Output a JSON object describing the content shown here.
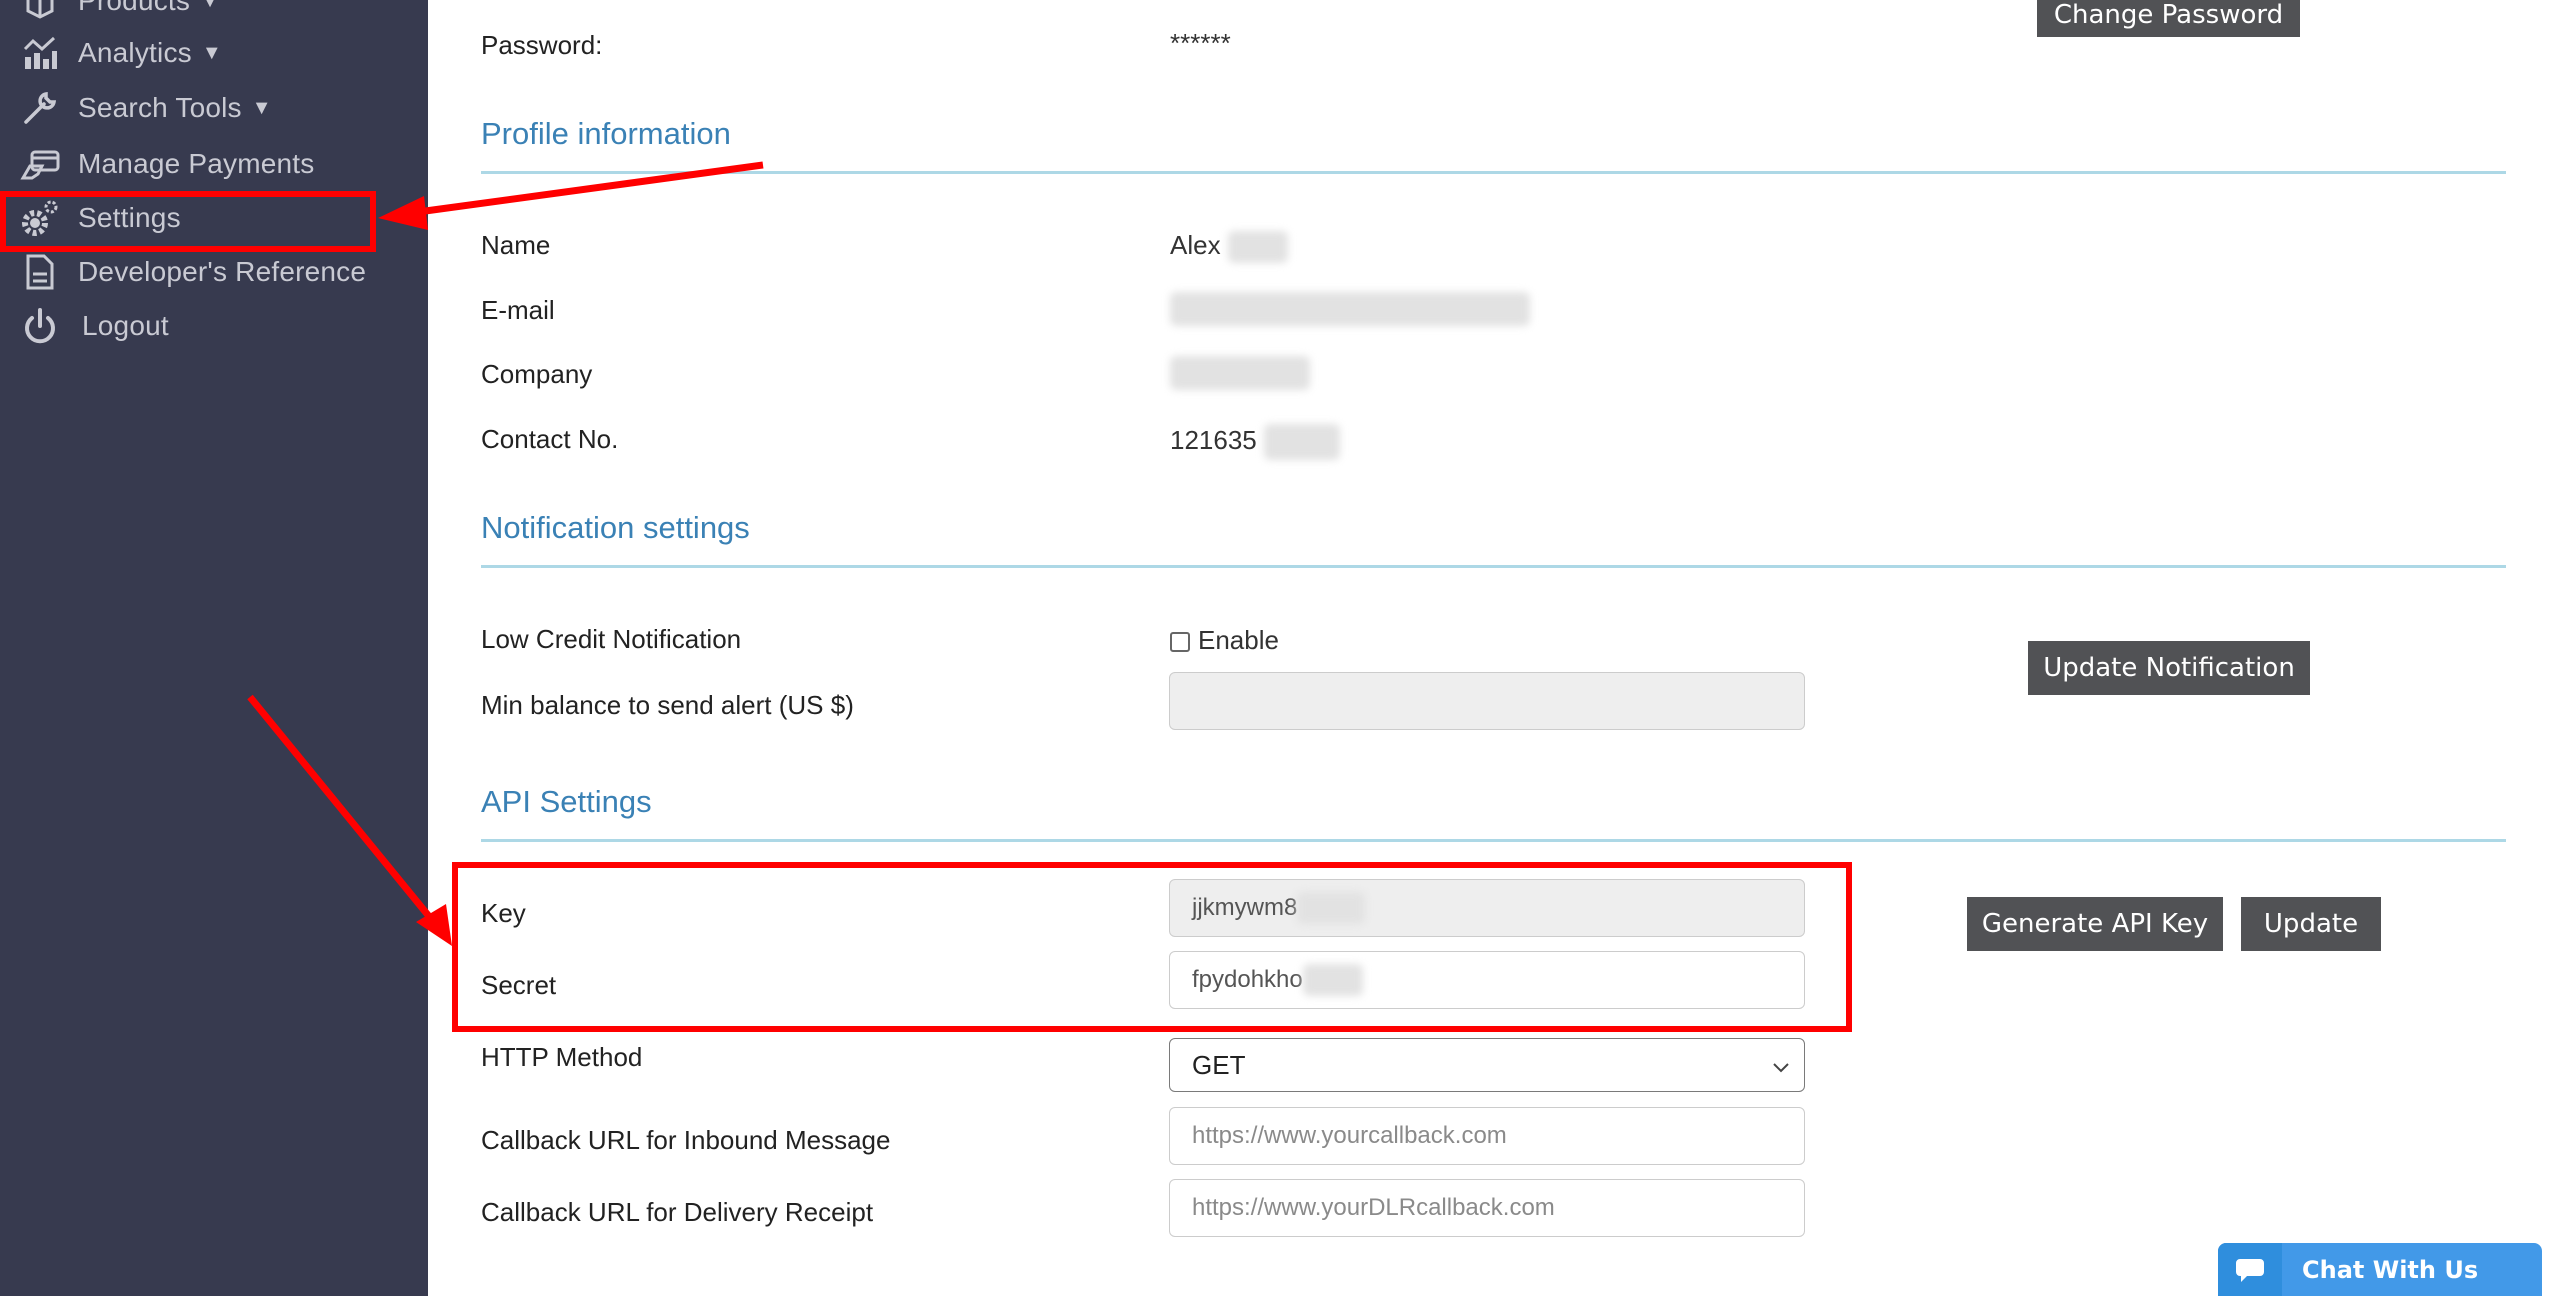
{
  "sidebar": {
    "items": [
      {
        "label": "Products",
        "caret": "▼",
        "icon": "box-icon"
      },
      {
        "label": "Analytics",
        "caret": "▼",
        "icon": "analytics-chart-icon"
      },
      {
        "label": "Search Tools",
        "caret": "▼",
        "icon": "search-tools-icon"
      },
      {
        "label": "Manage Payments",
        "icon": "payment-card-icon"
      },
      {
        "label": "Settings",
        "icon": "gears-icon",
        "active": true
      },
      {
        "label": "Developer's Reference",
        "icon": "document-icon"
      },
      {
        "label": "Logout",
        "icon": "power-icon"
      }
    ]
  },
  "account": {
    "password_label": "Password:",
    "password_value": "******",
    "change_password_button": "Change Password"
  },
  "profile": {
    "title": "Profile information",
    "name_label": "Name",
    "name_value": "Alex",
    "email_label": "E-mail",
    "company_label": "Company",
    "contact_label": "Contact No.",
    "contact_value": "121635"
  },
  "notification": {
    "title": "Notification settings",
    "low_credit_label": "Low Credit Notification",
    "enable_label": "Enable",
    "enable_checked": false,
    "min_balance_label": "Min balance to send alert (US $)",
    "min_balance_value": "",
    "update_button": "Update Notification"
  },
  "api": {
    "title": "API Settings",
    "key_label": "Key",
    "key_value": "jjkmywm8",
    "secret_label": "Secret",
    "secret_value": "fpydohkho",
    "generate_button": "Generate API Key",
    "update_button": "Update",
    "http_method_label": "HTTP Method",
    "http_method_value": "GET",
    "inbound_label": "Callback URL for Inbound Message",
    "inbound_placeholder": "https://www.yourcallback.com",
    "dlr_label": "Callback URL for Delivery Receipt",
    "dlr_placeholder": "https://www.yourDLRcallback.com"
  },
  "chat": {
    "label": "Chat With Us"
  },
  "colors": {
    "sidebar_bg": "#373a4f",
    "section_title": "#3a81b5",
    "section_rule": "#add8e6",
    "button_bg": "#515255",
    "annotation": "#ff0000",
    "chat_bg": "#4299e8"
  }
}
